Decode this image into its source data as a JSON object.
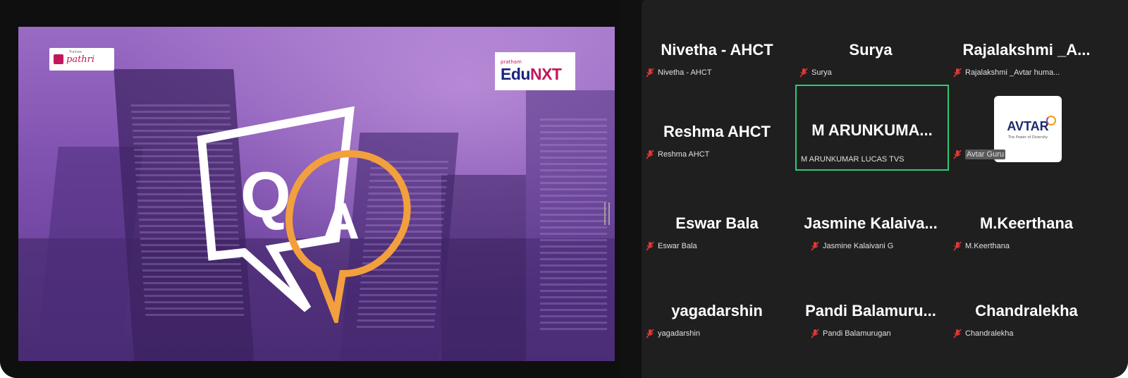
{
  "slide": {
    "logo_left": "pathri",
    "logo_left_small": "Trainee",
    "logo_right_small": "pratham",
    "logo_right_main": "Edu",
    "logo_right_accent": "NXT",
    "q_letter": "Q",
    "a_letter": "A"
  },
  "gallery": {
    "participants": [
      {
        "display_name": "Nivetha - AHCT",
        "label": "Nivetha - AHCT",
        "muted": true
      },
      {
        "display_name": "Surya",
        "label": "Surya",
        "muted": true
      },
      {
        "display_name": "Rajalakshmi _A...",
        "label": "Rajalakshmi _Avtar huma...",
        "muted": true
      },
      {
        "display_name": "Reshma AHCT",
        "label": "Reshma AHCT",
        "muted": true
      },
      {
        "display_name": "M ARUNKUMA...",
        "label": "M ARUNKUMAR LUCAS TVS",
        "muted": false,
        "active_speaker": true
      },
      {
        "display_name": "",
        "label": "Avtar Guru",
        "muted": true,
        "avatar_brand": "AVTAR",
        "avatar_tagline": "The Power of Diversity"
      },
      {
        "display_name": "Eswar Bala",
        "label": "Eswar Bala",
        "muted": true
      },
      {
        "display_name": "Jasmine Kalaiva...",
        "label": "Jasmine Kalaivani G",
        "muted": true
      },
      {
        "display_name": "M.Keerthana",
        "label": "M.Keerthana",
        "muted": true
      },
      {
        "display_name": "yagadarshin",
        "label": "yagadarshin",
        "muted": true
      },
      {
        "display_name": "Pandi Balamuru...",
        "label": "Pandi Balamurugan",
        "muted": true
      },
      {
        "display_name": "Chandralekha",
        "label": "Chandralekha",
        "muted": true
      }
    ]
  },
  "colors": {
    "muted_icon": "#e53935",
    "active_border": "#2ecc71",
    "q_bubble": "#ffffff",
    "a_bubble": "#f2a03d",
    "slide_purple": "#7d4fae"
  }
}
